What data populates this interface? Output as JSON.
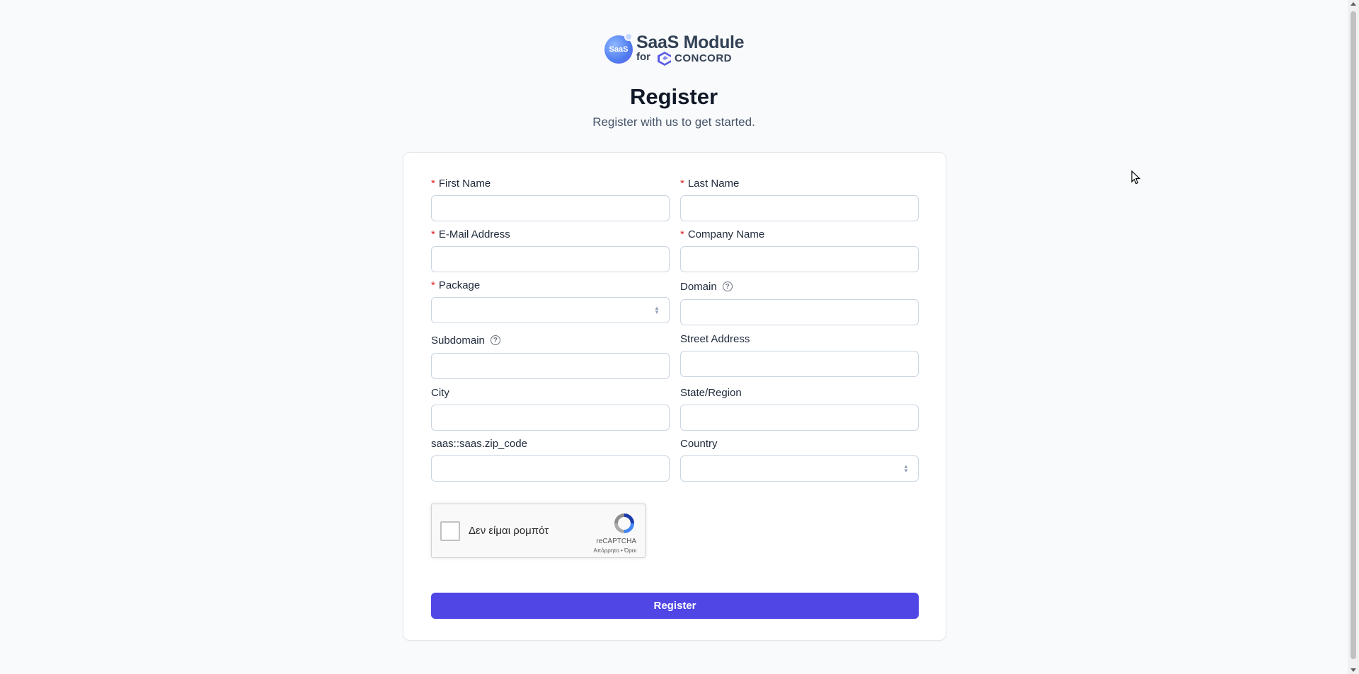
{
  "logo": {
    "badge_text": "SaaS",
    "title": "SaaS Module",
    "for_text": "for",
    "brand": "CONCORD",
    "icon": "concord-logo-icon"
  },
  "header": {
    "title": "Register",
    "subtitle": "Register with us to get started."
  },
  "form": {
    "required_marker": "*",
    "help_glyph": "?",
    "fields": {
      "first_name": {
        "label": "First Name",
        "value": ""
      },
      "last_name": {
        "label": "Last Name",
        "value": ""
      },
      "email": {
        "label": "E-Mail Address",
        "value": ""
      },
      "company_name": {
        "label": "Company Name",
        "value": ""
      },
      "package": {
        "label": "Package",
        "value": ""
      },
      "domain": {
        "label": "Domain",
        "value": ""
      },
      "subdomain": {
        "label": "Subdomain",
        "value": ""
      },
      "street_address": {
        "label": "Street Address",
        "value": ""
      },
      "city": {
        "label": "City",
        "value": ""
      },
      "state_region": {
        "label": "State/Region",
        "value": ""
      },
      "zip_code": {
        "label": "saas::saas.zip_code",
        "value": ""
      },
      "country": {
        "label": "Country",
        "value": ""
      }
    },
    "captcha": {
      "label": "Δεν είμαι ρομπότ",
      "brand": "reCAPTCHA",
      "terms": "Απόρρητο • Όροι"
    },
    "submit_label": "Register"
  },
  "colors": {
    "primary": "#4f46e5",
    "required": "#dc2626",
    "background": "#f8fafc"
  }
}
